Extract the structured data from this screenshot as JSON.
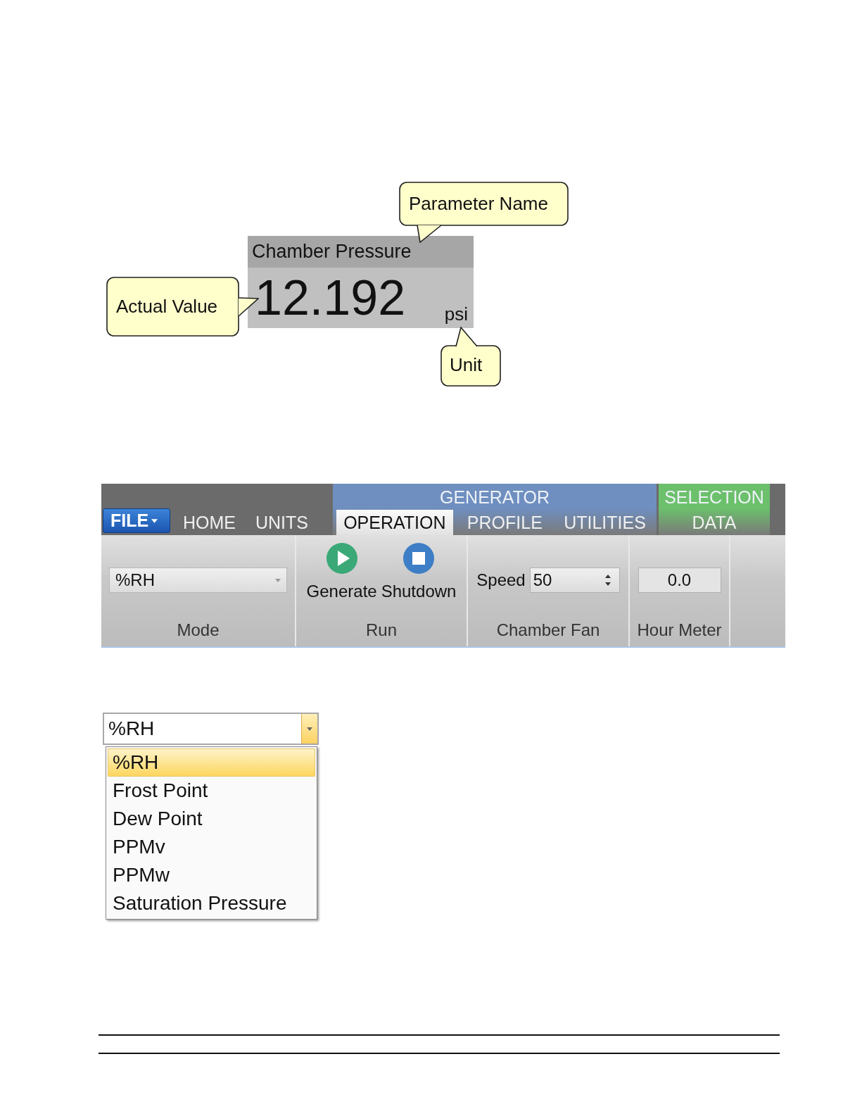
{
  "figure": {
    "parameter_name": "Chamber Pressure",
    "value": "12.192",
    "unit": "psi",
    "callouts": [
      {
        "kind": "name",
        "text": "Parameter Name"
      },
      {
        "kind": "value",
        "text": "Actual Value"
      },
      {
        "kind": "unit",
        "text": "Unit"
      }
    ]
  },
  "ribbon": {
    "file_button": "FILE",
    "tabs": [
      {
        "label": "HOME",
        "selected": false
      },
      {
        "label": "UNITS",
        "selected": false
      }
    ],
    "context_groups": [
      {
        "title": "GENERATOR",
        "color": "#6f8fc0",
        "tabs": [
          {
            "label": "OPERATION",
            "selected": true
          },
          {
            "label": "PROFILE",
            "selected": false
          },
          {
            "label": "UTILITIES",
            "selected": false
          }
        ]
      },
      {
        "title": "SELECTION",
        "color": "#6cc06c",
        "tabs": [
          {
            "label": "DATA",
            "selected": false
          }
        ]
      }
    ],
    "panels": [
      {
        "kind": "combo",
        "label": "Mode",
        "value": "%RH"
      },
      {
        "kind": "buttons",
        "label": "Run",
        "buttons": [
          {
            "kind": "play",
            "label": "Generate"
          },
          {
            "kind": "stop",
            "label": "Shutdown"
          }
        ]
      },
      {
        "kind": "spin",
        "label": "Chamber Fan",
        "field_label": "Speed",
        "value": "50"
      },
      {
        "kind": "readout",
        "label": "Hour Meter",
        "value": "0.0"
      }
    ]
  },
  "dropdown": {
    "value": "%RH",
    "expanded": true,
    "options": [
      {
        "label": "%RH",
        "selected": true
      },
      {
        "label": "Frost Point",
        "selected": false
      },
      {
        "label": "Dew Point",
        "selected": false
      },
      {
        "label": "PPMv",
        "selected": false
      },
      {
        "label": "PPMw",
        "selected": false
      },
      {
        "label": "Saturation Pressure",
        "selected": false
      }
    ]
  }
}
